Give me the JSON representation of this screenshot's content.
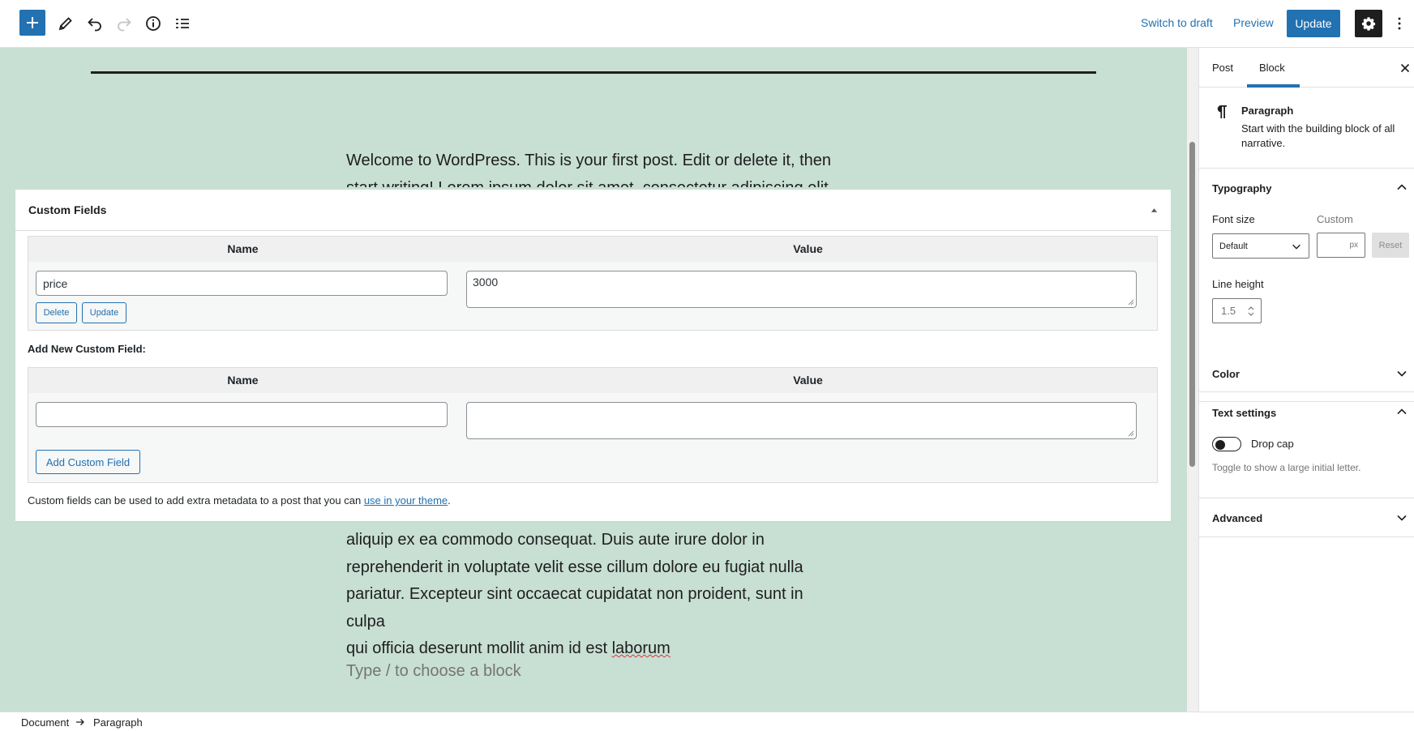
{
  "toolbar": {
    "inserter_icon": "plus-icon",
    "tools_icon": "pencil-icon",
    "undo_icon": "undo-icon",
    "redo_icon": "redo-icon",
    "details_icon": "info-icon",
    "list_view_icon": "list-view-icon",
    "switch_to_draft": "Switch to draft",
    "preview": "Preview",
    "update": "Update",
    "settings_icon": "gear-icon",
    "more_icon": "more-vertical-icon"
  },
  "editor": {
    "paragraph_top": "Welcome to WordPress. This is your first post. Edit or delete it, then start writing! Lorem ipsum dolor sit amet, consectetur adipiscing elit, sed",
    "paragraph_bottom_lines": [
      "aliquip ex ea commodo consequat. Duis aute irure dolor in",
      "reprehenderit in voluptate velit esse cillum dolore eu fugiat nulla",
      "pariatur. Excepteur sint occaecat cupidatat non proident, sunt in culpa"
    ],
    "paragraph_last_line_start": "qui officia deserunt mollit anim id est ",
    "paragraph_last_word": "laborum",
    "block_placeholder": "Type / to choose a block",
    "accent_color": "#c8dfd4"
  },
  "custom_fields": {
    "title": "Custom Fields",
    "header_name": "Name",
    "header_value": "Value",
    "existing": {
      "name": "price",
      "value": "3000",
      "delete_label": "Delete",
      "update_label": "Update"
    },
    "add_new_label": "Add New Custom Field:",
    "new_name": "",
    "new_value": "",
    "add_button": "Add Custom Field",
    "note_text": "Custom fields can be used to add extra metadata to a post that you can ",
    "note_link": "use in your theme",
    "note_end": "."
  },
  "sidebar": {
    "tab_post": "Post",
    "tab_block": "Block",
    "close_icon": "close-icon",
    "block_icon": "paragraph-icon",
    "block_name": "Paragraph",
    "block_desc": "Start with the building block of all narrative.",
    "typography_title": "Typography",
    "font_size_label": "Font size",
    "custom_label": "Custom",
    "font_size_value": "Default",
    "custom_unit": "px",
    "reset_label": "Reset",
    "line_height_label": "Line height",
    "line_height_value": "1.5",
    "color_title": "Color",
    "text_settings_title": "Text settings",
    "drop_cap_label": "Drop cap",
    "drop_cap_help": "Toggle to show a large initial letter.",
    "advanced_title": "Advanced"
  },
  "footer": {
    "crumb_document": "Document",
    "crumb_paragraph": "Paragraph"
  },
  "colors": {
    "primary": "#2271b1",
    "dark": "#1e1e1e"
  }
}
